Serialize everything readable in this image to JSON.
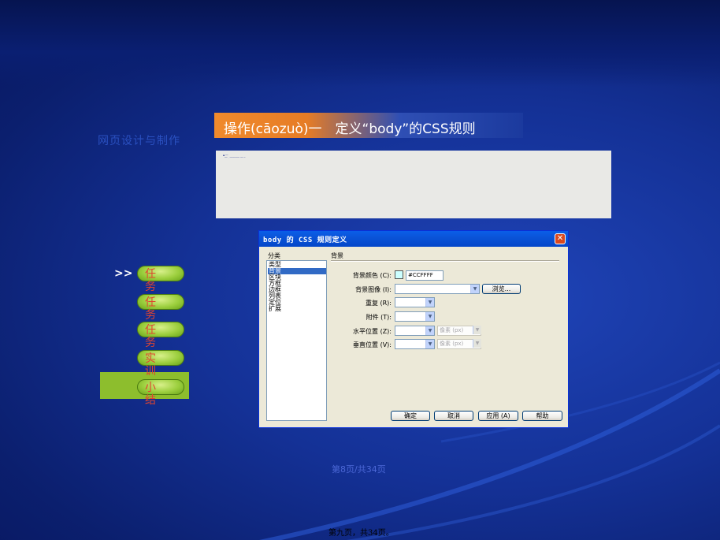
{
  "faint_title": "网页设计与制作",
  "header": {
    "title": "操作(cāozuò)一　定义“body”的CSS规则"
  },
  "panel": {
    "line1": "▪ ──",
    "line2": "── · ─────── ── ─"
  },
  "dialog": {
    "title": "body 的 CSS 规则定义",
    "close": "✕",
    "category_label": "分类",
    "categories": [
      "类型",
      "背景",
      "区块",
      "方框",
      "边框",
      "列表",
      "定位",
      "扩展"
    ],
    "selected_category": "背景",
    "section_label": "背景",
    "fields": {
      "bg_color_label": "背景颜色 (C):",
      "bg_color_value": "#CCFFFF",
      "bg_image_label": "背景图像 (I):",
      "browse": "浏览...",
      "repeat_label": "重复 (R):",
      "attach_label": "附件 (T):",
      "hpos_label": "水平位置 (Z):",
      "vpos_label": "垂直位置 (V):",
      "unit": "像素 (px)"
    },
    "buttons": {
      "ok": "确定",
      "cancel": "取消",
      "apply": "应用 (A)",
      "help": "帮助"
    }
  },
  "nav": {
    "arrow": ">>",
    "items": [
      {
        "label": "任务一"
      },
      {
        "label": "任务二"
      },
      {
        "label": "任务三"
      },
      {
        "label": "实训"
      },
      {
        "label": "小结"
      }
    ]
  },
  "page_center": "第8页/共34页",
  "page_bottom": "第九页，共34页。",
  "colors": {
    "accent_orange": "#f08a2c",
    "nav_green": "#9ccf3e",
    "nav_text": "#e0452f",
    "bg_blue": "#143196"
  }
}
